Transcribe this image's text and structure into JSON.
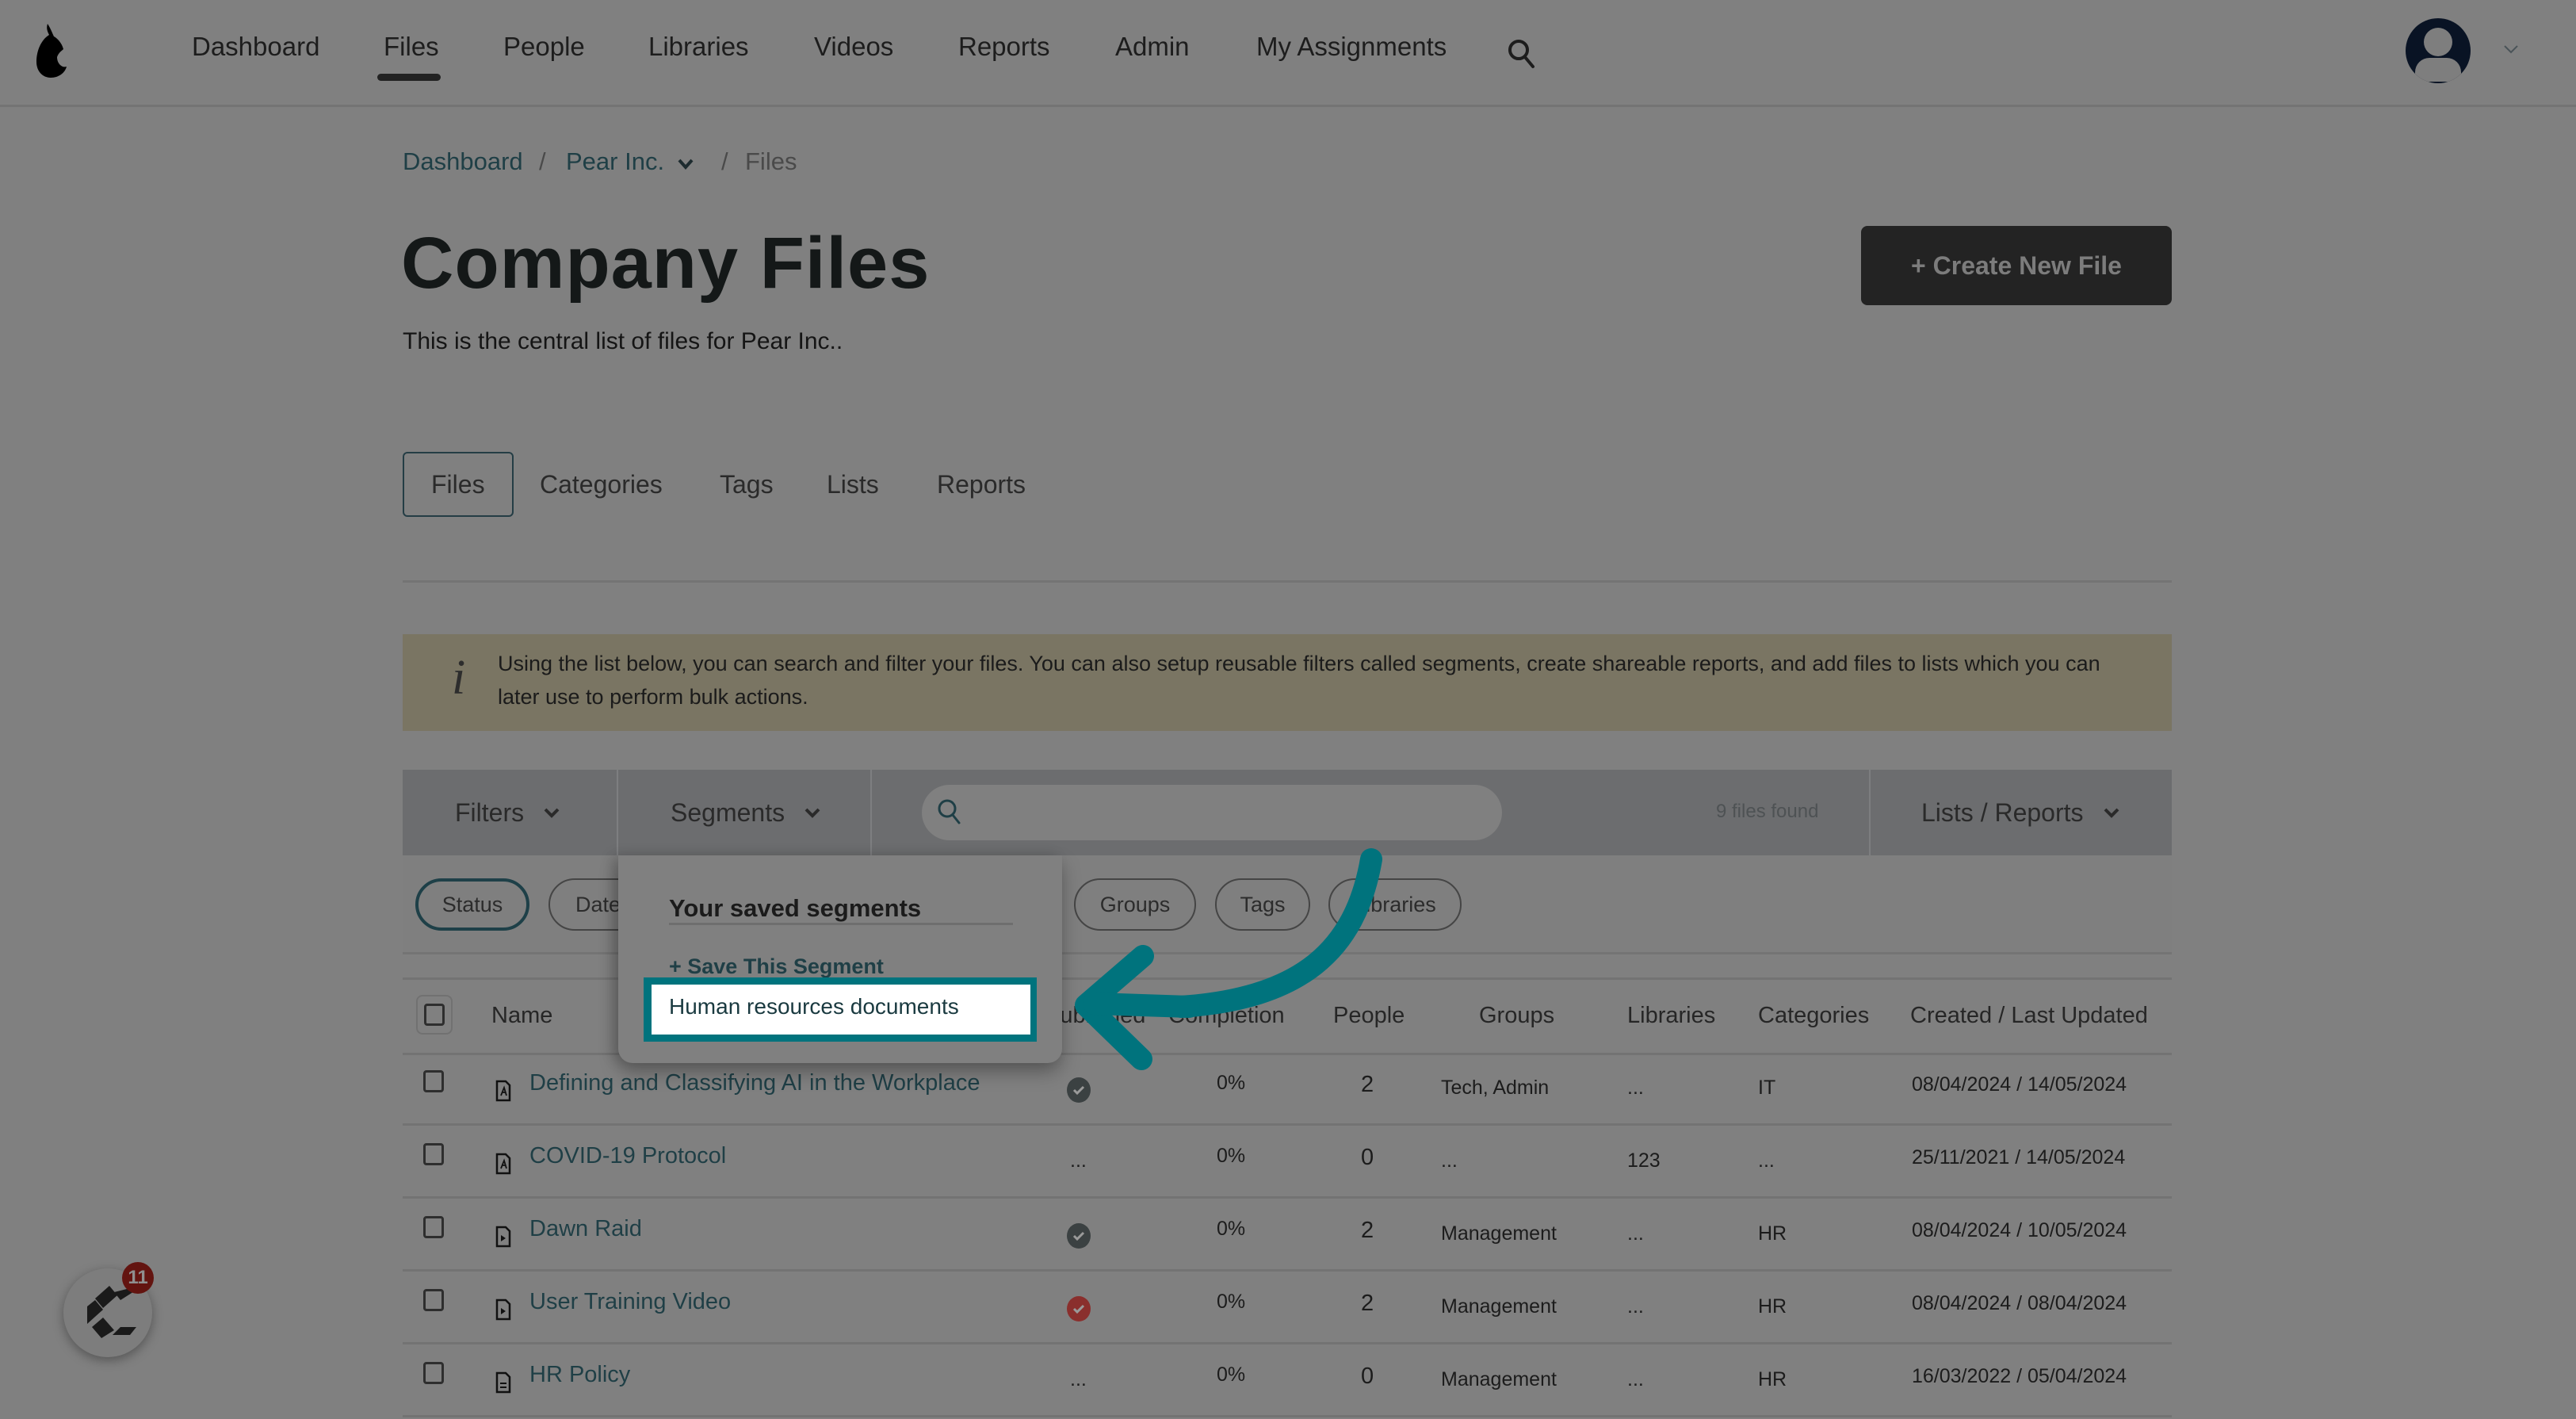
{
  "nav": {
    "items": [
      "Dashboard",
      "Files",
      "People",
      "Libraries",
      "Videos",
      "Reports",
      "Admin",
      "My Assignments"
    ],
    "active": "Files",
    "icons": {
      "logo": "pear-logo-icon",
      "search": "search-icon",
      "avatar": "user-avatar-icon",
      "menu": "chevron-down-icon"
    }
  },
  "breadcrumb": {
    "items": [
      "Dashboard",
      "Pear Inc.",
      "Files"
    ],
    "separator": "/"
  },
  "page": {
    "title": "Company Files",
    "subtitle": "This is the central list of files for Pear Inc..",
    "create_button": "+ Create New File"
  },
  "tabs": [
    "Files",
    "Categories",
    "Tags",
    "Lists",
    "Reports"
  ],
  "active_tab": "Files",
  "info": {
    "icon": "i",
    "text": "Using the list below, you can search and filter your files. You can also setup reusable filters called segments, create shareable reports, and add files to lists which you can later use to perform bulk actions."
  },
  "toolbar": {
    "filters": "Filters",
    "segments": "Segments",
    "search_placeholder": "",
    "search_value": "",
    "files_found": "9 files found",
    "lists_reports": "Lists / Reports"
  },
  "filter_chips": [
    "Status",
    "Date",
    "Groups",
    "Tags",
    "Libraries"
  ],
  "active_chip": "Status",
  "segments_dropdown": {
    "title": "Your saved segments",
    "save_label": "+ Save This Segment",
    "items": [
      "Human resources documents"
    ]
  },
  "table": {
    "columns": [
      "Name",
      "Published",
      "Completion",
      "People",
      "Groups",
      "Libraries",
      "Categories",
      "Created / Last Updated"
    ],
    "rows": [
      {
        "name": "Defining and Classifying AI in the Workplace",
        "file_type": "pdf",
        "published": "published",
        "completion": "0%",
        "people": "2",
        "groups": "Tech, Admin",
        "libraries": "...",
        "categories": "IT",
        "dates": "08/04/2024 / 14/05/2024"
      },
      {
        "name": "COVID-19 Protocol",
        "file_type": "pdf",
        "published": "...",
        "completion": "0%",
        "people": "0",
        "groups": "...",
        "libraries": "123",
        "categories": "...",
        "dates": "25/11/2021 / 14/05/2024"
      },
      {
        "name": "Dawn Raid",
        "file_type": "video",
        "published": "published",
        "completion": "0%",
        "people": "2",
        "groups": "Management",
        "libraries": "...",
        "categories": "HR",
        "dates": "08/04/2024 / 10/05/2024"
      },
      {
        "name": "User Training Video",
        "file_type": "video",
        "published": "published-alert",
        "completion": "0%",
        "people": "2",
        "groups": "Management",
        "libraries": "...",
        "categories": "HR",
        "dates": "08/04/2024 / 08/04/2024"
      },
      {
        "name": "HR Policy",
        "file_type": "document",
        "published": "...",
        "completion": "0%",
        "people": "0",
        "groups": "Management",
        "libraries": "...",
        "categories": "HR",
        "dates": "16/03/2022 / 05/04/2024"
      }
    ]
  },
  "chat_widget": {
    "badge_count": "11"
  },
  "colors": {
    "accent": "#00737d",
    "link": "#1f3f46",
    "status_ok": "#3b4142",
    "status_alert": "#8a2f2d",
    "overlay": "#808080"
  }
}
